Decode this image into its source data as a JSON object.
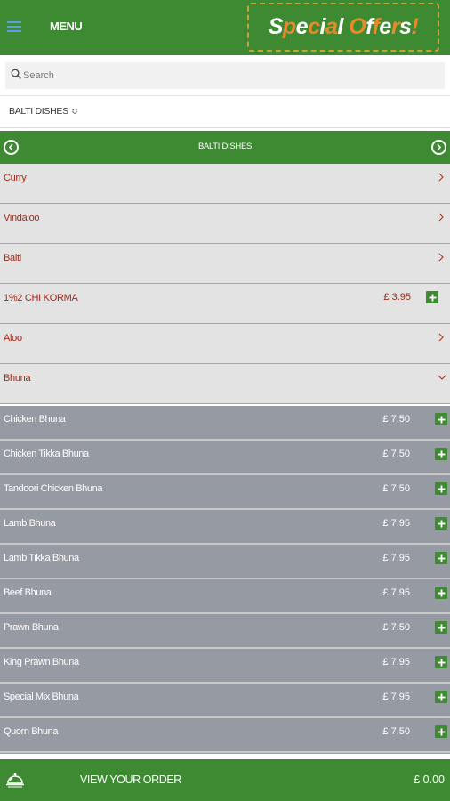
{
  "header": {
    "menu_label": "MENU",
    "special_offers": "Special Offers!"
  },
  "search": {
    "placeholder": "Search"
  },
  "category_select": {
    "selected": "BALTI DISHES",
    "arrows": "≎"
  },
  "category_header": {
    "title": "BALTI DISHES"
  },
  "categories": [
    {
      "label": "Curry",
      "kind": "expandable",
      "expanded": false
    },
    {
      "label": "Vindaloo",
      "kind": "expandable",
      "expanded": false
    },
    {
      "label": "Balti",
      "kind": "expandable",
      "expanded": false
    },
    {
      "label": "1%2 CHI KORMA",
      "kind": "item",
      "price": "£ 3.95"
    },
    {
      "label": "Aloo",
      "kind": "expandable",
      "expanded": false
    },
    {
      "label": "Bhuna",
      "kind": "expandable",
      "expanded": true
    }
  ],
  "items": [
    {
      "name": "Chicken Bhuna",
      "price": "£ 7.50"
    },
    {
      "name": "Chicken Tikka Bhuna",
      "price": "£ 7.50"
    },
    {
      "name": "Tandoori Chicken Bhuna",
      "price": "£ 7.50"
    },
    {
      "name": "Lamb Bhuna",
      "price": "£ 7.95"
    },
    {
      "name": "Lamb Tikka Bhuna",
      "price": "£ 7.95"
    },
    {
      "name": "Beef Bhuna",
      "price": "£ 7.95"
    },
    {
      "name": "Prawn Bhuna",
      "price": "£ 7.50"
    },
    {
      "name": "King Prawn Bhuna",
      "price": "£ 7.95"
    },
    {
      "name": "Special Mix Bhuna",
      "price": "£ 7.95"
    },
    {
      "name": "Quorn Bhuna",
      "price": "£ 7.50"
    }
  ],
  "footer": {
    "view_order": "VIEW YOUR ORDER",
    "total": "£ 0.00"
  },
  "icons": {
    "menu": "hamburger-icon",
    "search": "search-icon",
    "prev": "chevron-left-circle-icon",
    "next": "chevron-right-circle-icon",
    "row_collapsed": "chevron-right-icon",
    "row_expanded": "chevron-down-icon",
    "add": "plus-icon",
    "order": "cloche-icon"
  },
  "colors": {
    "brand_green": "#3e8a33",
    "offer_orange": "#e8892a",
    "offer_white": "#ffffff",
    "category_text": "#9e2a1a",
    "item_bg": "#969aa2"
  }
}
